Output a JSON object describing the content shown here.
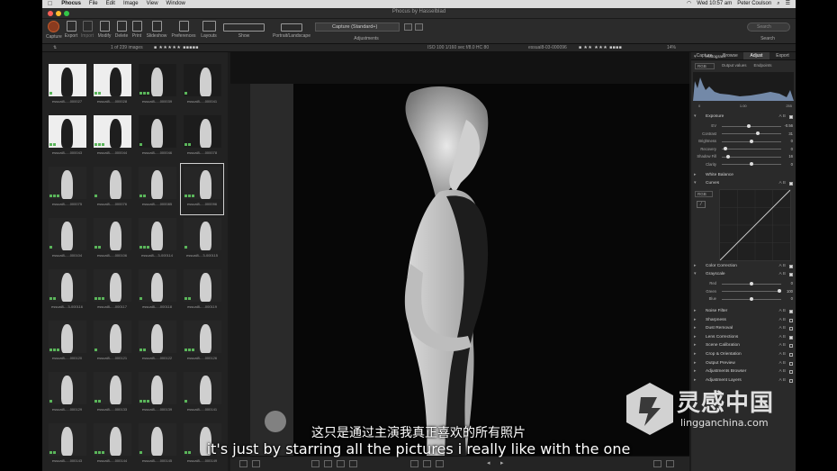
{
  "menubar": {
    "app": "Phocus",
    "items": [
      "File",
      "Edit",
      "Image",
      "View",
      "Window"
    ],
    "clock": "Wed 10:57 am",
    "user": "Peter Coulson"
  },
  "window": {
    "title": "Phocus by Hasselblad"
  },
  "toolbar": {
    "buttons": [
      "Capture",
      "Export",
      "Import",
      "Modify",
      "Delete",
      "Print",
      "Slideshow",
      "Preferences",
      "Layouts"
    ],
    "show_label": "Show",
    "portrait_label": "Portrait/Landscape",
    "style_value": "Capture (Standard+)",
    "adjustments_label": "Adjustments",
    "search_placeholder": "Search",
    "search_label": "Search"
  },
  "strip": {
    "count": "1 of 239 images",
    "exposure": "ISO 100  1/160 sec  f/8.0  HC 80",
    "filename": "essual8-03-000096",
    "zoom": "14%"
  },
  "thumbnails": [
    [
      "essual8-...-000027",
      "essual8-...-000028",
      "essual8-...-000039",
      "essual8-...-000041"
    ],
    [
      "essual8-...-000043",
      "essual8-...-000044",
      "essual8-...-000046",
      "essual8-...-000078"
    ],
    [
      "essual8-...-000075",
      "essual8-...-000076",
      "essual8-...-000085",
      "essual8-...-000096"
    ],
    [
      "essual8-...-000104",
      "essual8-...-000106",
      "essual8-...3-000114",
      "essual8-...3-000115"
    ],
    [
      "essual8-...3-000116",
      "essual8-...-000117",
      "essual8-...-000118",
      "essual8-...-000119"
    ],
    [
      "essual8-...-000120",
      "essual8-...-000121",
      "essual8-...-000122",
      "essual8-...-000126"
    ],
    [
      "essual8-...-000129",
      "essual8-...-000133",
      "essual8-...-000139",
      "essual8-...-000141"
    ],
    [
      "essual8-...-000143",
      "essual8-...-000144",
      "essual8-...-000145",
      "essual8-...-000149"
    ]
  ],
  "tools": {
    "tabs": [
      "Capture",
      "Browse",
      "Adjust",
      "Export"
    ],
    "active_tab": "Adjust",
    "histogram": {
      "title": "Histogram",
      "mode": "RGB",
      "output_values": "Output values",
      "endpoints": "Endpoints",
      "lo": "0",
      "mid": "1.00",
      "hi": "255"
    },
    "exposure": {
      "title": "Exposure",
      "rows": [
        {
          "label": "EV",
          "value": "-0.56"
        },
        {
          "label": "Contrast",
          "value": "31"
        },
        {
          "label": "Brightness",
          "value": "0"
        },
        {
          "label": "Recovery",
          "value": "0"
        },
        {
          "label": "Shadow Fill",
          "value": "16"
        },
        {
          "label": "Clarity",
          "value": "0"
        }
      ]
    },
    "white_balance": "White Balance",
    "curves": "Curves",
    "curves_mode": "RGB",
    "color_correction": "Color Correction",
    "grayscale": {
      "title": "Grayscale",
      "rows": [
        {
          "label": "Red",
          "value": "0"
        },
        {
          "label": "Green",
          "value": "100"
        },
        {
          "label": "Blue",
          "value": "0"
        }
      ]
    },
    "sections": [
      "Noise Filter",
      "Sharpness",
      "Dust Removal",
      "Lens Corrections",
      "Scene Calibration",
      "Crop & Orientation",
      "Output Preview",
      "Adjustments Browser",
      "Adjustment Layers"
    ]
  },
  "subtitles": {
    "cn": "这只是通过主演我真正喜欢的所有照片",
    "en": "it's just by starring all the pictures i really like with the one"
  },
  "watermark": {
    "cn": "灵感中国",
    "en": "lingganchina.com"
  }
}
